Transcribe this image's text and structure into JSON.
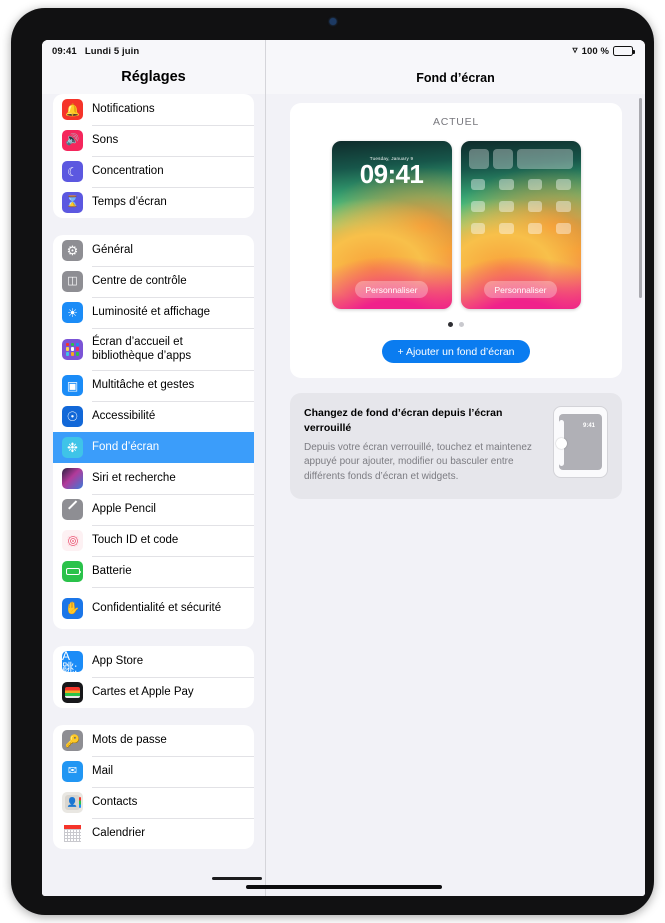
{
  "status_bar": {
    "time": "09:41",
    "date": "Lundi 5 juin",
    "wifi_icon": "wifi-icon",
    "battery_percent": "100 %",
    "battery_icon": "battery-full-icon"
  },
  "sidebar": {
    "title": "Réglages",
    "groups": [
      {
        "items": [
          {
            "label": "Notifications",
            "icon": "notifications-icon",
            "selected": false
          },
          {
            "label": "Sons",
            "icon": "sounds-icon",
            "selected": false
          },
          {
            "label": "Concentration",
            "icon": "focus-moon-icon",
            "selected": false
          },
          {
            "label": "Temps d’écran",
            "icon": "screen-time-hourglass-icon",
            "selected": false
          }
        ]
      },
      {
        "items": [
          {
            "label": "Général",
            "icon": "general-gear-icon",
            "selected": false
          },
          {
            "label": "Centre de contrôle",
            "icon": "control-center-icon",
            "selected": false
          },
          {
            "label": "Luminosité et affichage",
            "icon": "brightness-sun-icon",
            "selected": false
          },
          {
            "label": "Écran d’accueil et bibliothèque d’apps",
            "icon": "home-screen-grid-icon",
            "selected": false
          },
          {
            "label": "Multitâche et gestes",
            "icon": "multitasking-icon",
            "selected": false
          },
          {
            "label": "Accessibilité",
            "icon": "accessibility-icon",
            "selected": false
          },
          {
            "label": "Fond d’écran",
            "icon": "wallpaper-icon",
            "selected": true
          },
          {
            "label": "Siri et recherche",
            "icon": "siri-icon",
            "selected": false
          },
          {
            "label": "Apple Pencil",
            "icon": "apple-pencil-icon",
            "selected": false
          },
          {
            "label": "Touch ID et code",
            "icon": "touch-id-icon",
            "selected": false
          },
          {
            "label": "Batterie",
            "icon": "battery-icon",
            "selected": false
          },
          {
            "label": "Confidentialité et sécurité",
            "icon": "privacy-hand-icon",
            "selected": false
          }
        ]
      },
      {
        "items": [
          {
            "label": "App Store",
            "icon": "app-store-icon",
            "selected": false
          },
          {
            "label": "Cartes et Apple Pay",
            "icon": "wallet-icon",
            "selected": false
          }
        ]
      },
      {
        "items": [
          {
            "label": "Mots de passe",
            "icon": "passwords-key-icon",
            "selected": false
          },
          {
            "label": "Mail",
            "icon": "mail-icon",
            "selected": false
          },
          {
            "label": "Contacts",
            "icon": "contacts-icon",
            "selected": false
          },
          {
            "label": "Calendrier",
            "icon": "calendar-icon",
            "selected": false
          }
        ]
      }
    ]
  },
  "content": {
    "title": "Fond d’écran",
    "current_section_label": "ACTUEL",
    "previews": [
      {
        "kind": "lock-screen",
        "date": "Tuesday, January 9",
        "time": "09:41",
        "customize_label": "Personnaliser"
      },
      {
        "kind": "home-screen",
        "customize_label": "Personnaliser"
      }
    ],
    "page_dots": {
      "count": 2,
      "active_index": 0
    },
    "add_wallpaper_label": "+ Ajouter un fond d’écran",
    "info_card": {
      "title": "Changez de fond d’écran depuis l’écran verrouillé",
      "body": "Depuis votre écran verrouillé, touchez et maintenez appuyé pour ajouter, modifier ou basculer entre différents fonds d’écran et widgets.",
      "device_time": "9:41"
    }
  },
  "colors": {
    "accent_blue": "#0a7cf0",
    "selected_row": "#3b9dfa",
    "page_background": "#f2f2f7",
    "card_background": "#ffffff",
    "info_card_background": "#e6e6eb"
  }
}
